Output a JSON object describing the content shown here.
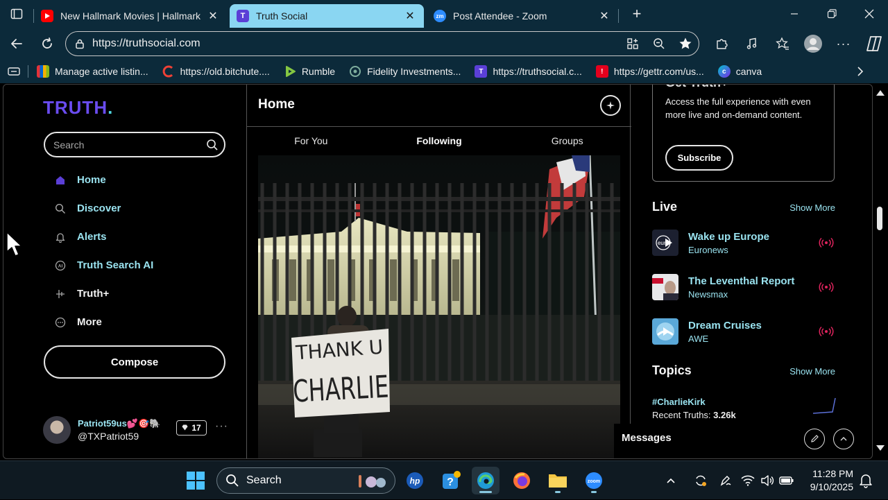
{
  "browser": {
    "tabs": [
      {
        "title": "New Hallmark Movies | Hallmark C",
        "favicon": "youtube-icon",
        "active": false
      },
      {
        "title": "Truth Social",
        "favicon": "truth-social-icon",
        "active": true
      },
      {
        "title": "Post Attendee - Zoom",
        "favicon": "zoom-icon",
        "active": false
      }
    ],
    "url": "https://truthsocial.com",
    "bookmarks": [
      {
        "label": "Manage active listin...",
        "icon": "ebay-icon"
      },
      {
        "label": "https://old.bitchute....",
        "icon": "bitchute-icon"
      },
      {
        "label": "Rumble",
        "icon": "rumble-icon"
      },
      {
        "label": "Fidelity Investments...",
        "icon": "fidelity-icon"
      },
      {
        "label": "https://truthsocial.c...",
        "icon": "truth-social-icon"
      },
      {
        "label": "https://gettr.com/us...",
        "icon": "gettr-icon"
      },
      {
        "label": "canva",
        "icon": "canva-icon"
      }
    ]
  },
  "sidebar": {
    "logo": "TRUTH",
    "logo_dot": ".",
    "search_placeholder": "Search",
    "nav": [
      {
        "label": "Home",
        "icon": "home-icon"
      },
      {
        "label": "Discover",
        "icon": "search-icon"
      },
      {
        "label": "Alerts",
        "icon": "bell-icon"
      },
      {
        "label": "Truth Search AI",
        "icon": "ai-icon"
      },
      {
        "label": "Truth+",
        "icon": "truth-plus-icon"
      },
      {
        "label": "More",
        "icon": "more-icon"
      }
    ],
    "compose_label": "Compose",
    "profile": {
      "display_name": "Patriot59us💕🎯🐘",
      "handle": "@TXPatriot59",
      "points": "17"
    }
  },
  "feed": {
    "title": "Home",
    "tabs": [
      "For You",
      "Following",
      "Groups"
    ],
    "selected_tab": "Following",
    "image_sign_text": [
      "THANK U",
      "CHARLIE"
    ]
  },
  "right": {
    "truthplus": {
      "title": "Get Truth+",
      "body": "Access the full experience with even more live and on-demand content.",
      "button": "Subscribe"
    },
    "live": {
      "title": "Live",
      "show_more": "Show More",
      "items": [
        {
          "name": "Wake up Europe",
          "source": "Euronews"
        },
        {
          "name": "The Leventhal Report",
          "source": "Newsmax"
        },
        {
          "name": "Dream Cruises",
          "source": "AWE"
        }
      ]
    },
    "topics": {
      "title": "Topics",
      "show_more": "Show More",
      "tag": "#CharlieKirk",
      "count_label": "Recent Truths:",
      "count_value": "3.26k"
    },
    "messages": "Messages"
  },
  "taskbar": {
    "search": "Search",
    "time": "11:28 PM",
    "date": "9/10/2025"
  },
  "colors": {
    "accent": "#9ae3f0",
    "brand": "#6a4cf0",
    "live_red": "#e0245e",
    "browser_chrome": "#0c2a3a",
    "active_tab": "#8ad6f2"
  }
}
